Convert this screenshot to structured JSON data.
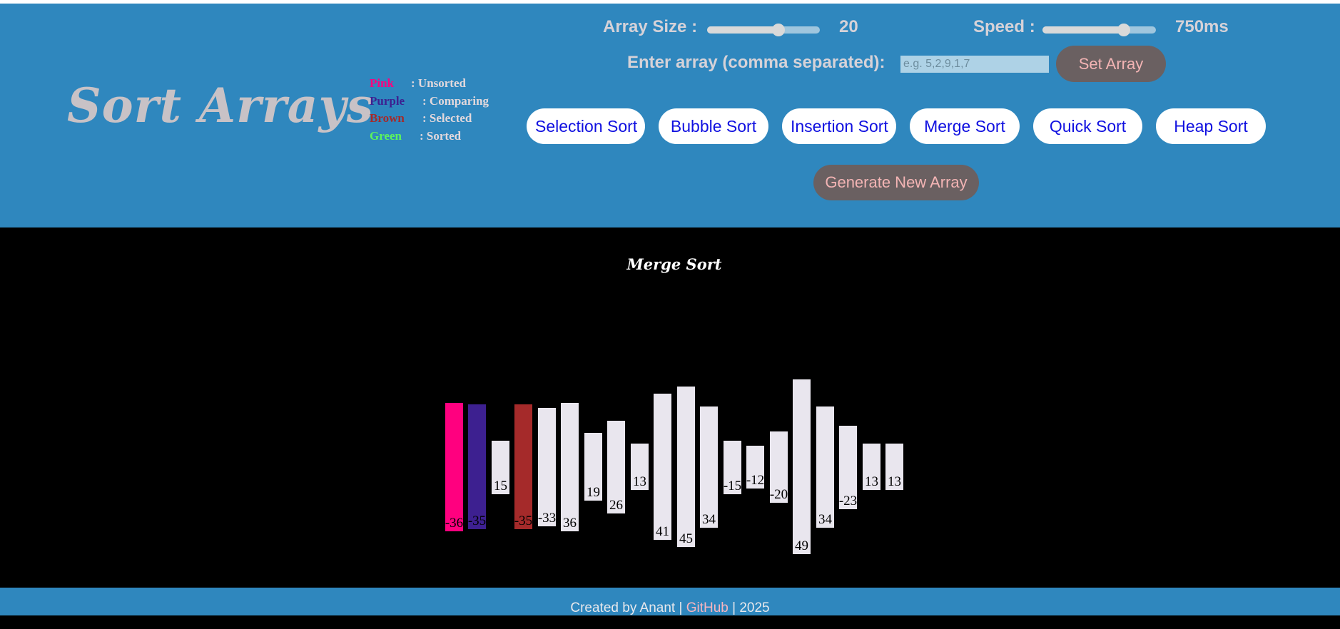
{
  "header": {
    "logo": "Sort Arrays",
    "legend": [
      {
        "key": "Pink",
        "label": ": Unsorted",
        "color": "#ff007f"
      },
      {
        "key": "Purple",
        "label": ": Comparing",
        "color": "#3d2090"
      },
      {
        "key": "Brown",
        "label": ": Selected",
        "color": "#a52a2a"
      },
      {
        "key": "Green",
        "label": ": Sorted",
        "color": "#5cf55c"
      }
    ],
    "array_size": {
      "label": "Array Size :",
      "value": "20",
      "level": 0.63
    },
    "speed": {
      "label": "Speed :",
      "value": "750ms",
      "level": 0.72
    },
    "input": {
      "label": "Enter array (comma separated):",
      "placeholder": "e.g. 5,2,9,1,7"
    },
    "set_array_label": "Set Array",
    "algorithms": [
      "Selection Sort",
      "Bubble Sort",
      "Insertion Sort",
      "Merge Sort",
      "Quick Sort",
      "Heap Sort"
    ],
    "generate_label": "Generate New Array"
  },
  "visualizer": {
    "title": "Merge Sort",
    "bars": [
      {
        "value": "-36",
        "state": "unsorted"
      },
      {
        "value": "-35",
        "state": "comparing"
      },
      {
        "value": "15",
        "state": "default"
      },
      {
        "value": "-35",
        "state": "selected"
      },
      {
        "value": "-33",
        "state": "default"
      },
      {
        "value": "36",
        "state": "default"
      },
      {
        "value": "19",
        "state": "default"
      },
      {
        "value": "26",
        "state": "default"
      },
      {
        "value": "13",
        "state": "default"
      },
      {
        "value": "41",
        "state": "default"
      },
      {
        "value": "45",
        "state": "default"
      },
      {
        "value": "34",
        "state": "default"
      },
      {
        "value": "-15",
        "state": "default"
      },
      {
        "value": "-12",
        "state": "default"
      },
      {
        "value": "-20",
        "state": "default"
      },
      {
        "value": "49",
        "state": "default"
      },
      {
        "value": "34",
        "state": "default"
      },
      {
        "value": "-23",
        "state": "default"
      },
      {
        "value": "13",
        "state": "default"
      },
      {
        "value": "13",
        "state": "default"
      }
    ],
    "state_colors": {
      "unsorted": "#ff007f",
      "comparing": "#3d2090",
      "selected": "#a52a2a",
      "default": "#e9e6ee"
    }
  },
  "footer": {
    "prefix": "Created by Anant | ",
    "link": "GitHub",
    "suffix": " | 2025"
  }
}
